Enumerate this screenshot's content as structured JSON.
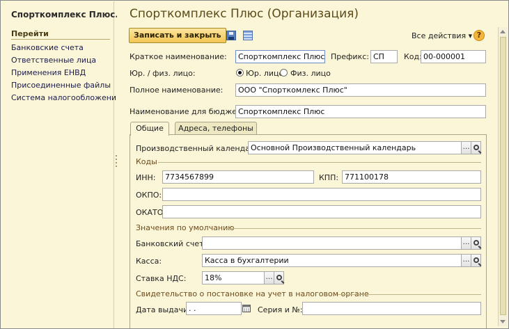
{
  "sidebar": {
    "app_title": "Спорткомплекс Плюс...",
    "nav_title": "Перейти",
    "items": [
      {
        "label": "Банковские счета"
      },
      {
        "label": "Ответственные лица"
      },
      {
        "label": "Применения ЕНВД"
      },
      {
        "label": "Присоединенные файлы"
      },
      {
        "label": "Система налогообложения"
      }
    ]
  },
  "header": {
    "title": "Спорткомплекс Плюс (Организация)"
  },
  "toolbar": {
    "save_close_label": "Записать и закрыть",
    "all_actions_label": "Все действия ▾",
    "help_label": "?",
    "icons": [
      "save-icon",
      "document-icon",
      "help-icon"
    ]
  },
  "form": {
    "short_name_label": "Краткое наименование:",
    "short_name_value": "Спорткомплекс Плюс",
    "prefix_label": "Префикс:",
    "prefix_value": "СП",
    "code_label": "Код:",
    "code_value": "00-000001",
    "person_type_label": "Юр. / физ. лицо:",
    "person_type_options": [
      {
        "label": "Юр. лицо",
        "selected": true
      },
      {
        "label": "Физ. лицо",
        "selected": false
      }
    ],
    "full_name_label": "Полное наименование:",
    "full_name_value": "ООО \"Спорткомлекс Плюс\"",
    "budget_name_label": "Наименование для бюджета:",
    "budget_name_value": "Спорткомплекс Плюс"
  },
  "tabs": [
    {
      "label": "Общие",
      "active": true
    },
    {
      "label": "Адреса, телефоны",
      "active": false
    }
  ],
  "general": {
    "calendar_label": "Производственный календарь:",
    "calendar_value": "Основной Производственный календарь",
    "codes_group": "Коды",
    "inn_label": "ИНН:",
    "inn_value": "7734567899",
    "kpp_label": "КПП:",
    "kpp_value": "771100178",
    "okpo_label": "ОКПО:",
    "okpo_value": "",
    "okato_label": "ОКАТО:",
    "okato_value": "",
    "defaults_group": "Значения по умолчанию",
    "bank_account_label": "Банковский счет:",
    "bank_account_value": "",
    "cash_label": "Касса:",
    "cash_value": "Касса в бухгалтерии",
    "vat_label": "Ставка НДС:",
    "vat_value": "18%",
    "certificate_group": "Свидетельство о постановке на учет в налоговом органе",
    "issue_date_label": "Дата выдачи:",
    "issue_date_value": " .  .",
    "series_label": "Серия и №:",
    "series_value": ""
  },
  "colors": {
    "background": "#fbf6d8",
    "accent_button": "#f3c654",
    "title_text": "#5a4a18",
    "group_title": "#6b4a1a"
  }
}
